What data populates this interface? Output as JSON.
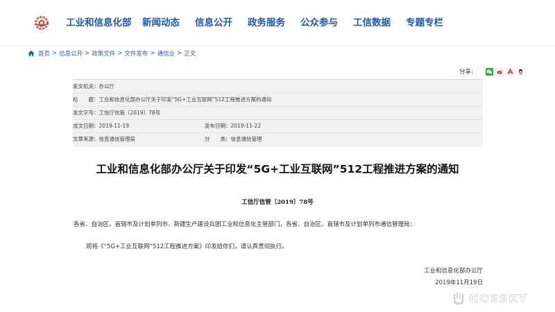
{
  "nav": {
    "items": [
      "工业和信息化部",
      "新闻动态",
      "信息公开",
      "政务服务",
      "公众参与",
      "工信数据",
      "专题专栏"
    ]
  },
  "breadcrumb": {
    "items": [
      "首页",
      "信息公开",
      "政策文件",
      "文件发布",
      "通信业",
      "正文"
    ],
    "separator": ">"
  },
  "share": {
    "label": "分享:"
  },
  "meta": {
    "issuer_label": "发文机关：",
    "issuer": "办公厅",
    "subject_label": "标　　题：",
    "subject": "工业和信息化部办公厅关于印发“5G+工业互联网”512工程推进方案的通知",
    "docno_label": "发文字号：",
    "docno": "工信厅信管〔2019〕78号",
    "written_label": "成文日期：",
    "written": "2019-11-19",
    "published_label": "发布日期：",
    "published": "2019-11-22",
    "source_label": "文章来源：",
    "source": "信息通信管理局",
    "category_label": "分　　类：",
    "category": "信息通信管理"
  },
  "article": {
    "title": "工业和信息化部办公厅关于印发“5G+工业互联网”512工程推进方案的通知",
    "docno": "工信厅信管〔2019〕78号",
    "recipients": "各省、自治区、直辖市及计划单列市、新疆生产建设兵团工业和信息化主管部门，各省、自治区、直辖市及计划单列市通信管理局：",
    "body": "现将《“5G+工业互联网”512工程推进方案》印发给你们，请认真贯彻执行。",
    "signature": "工业和信息化部办公厅",
    "date": "2019年11月19日"
  },
  "watermark": {
    "text": "HOSSKY"
  },
  "colors": {
    "nav": "#1f5aa8",
    "link": "#2b62b0",
    "meta_bg": "#f1f1f1"
  }
}
